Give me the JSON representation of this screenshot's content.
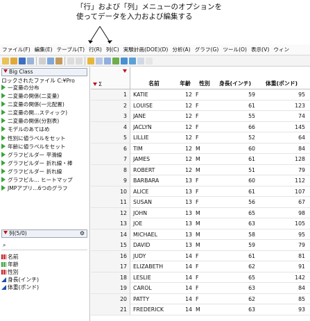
{
  "callout": {
    "line1": "「行」および「列」メニューのオプションを",
    "line2": "使ってデータを入力および編集する"
  },
  "menubar": {
    "items": [
      "ファイル(F)",
      "編集(E)",
      "テーブル(T)",
      "行(R)",
      "列(C)",
      "実験計画(DOE)(D)",
      "分析(A)",
      "グラフ(G)",
      "ツール(O)",
      "表示(V)",
      "ウィン"
    ]
  },
  "table_panel": {
    "title": "Big Class",
    "source_label": "ロックされたファイル  C:¥Pro",
    "scripts": [
      "一変量の分布",
      "二変量の関係(二変量)",
      "二変量の関係(一元配置)",
      "二変量の関…スティック)",
      "二変量の関係(分割表)",
      "モデルのあてはめ",
      "性別に値ラベルをセット",
      "年齢に値ラベルをセット",
      "グラフビルダー  平滑線",
      "グラフビルダー  折れ線・棒",
      "グラフビルダー  折れ線",
      "グラフビル…  ヒートマップ",
      "JMPアプリ…6つのグラフ"
    ]
  },
  "columns_panel": {
    "title": "列(5/0)",
    "search_placeholder": "",
    "columns": [
      {
        "name": "名前",
        "type": "nominal"
      },
      {
        "name": "年齢",
        "type": "ordinal"
      },
      {
        "name": "性別",
        "type": "nominal"
      },
      {
        "name": "身長(インチ)",
        "type": "continuous"
      },
      {
        "name": "体重(ポンド)",
        "type": "continuous"
      }
    ]
  },
  "grid": {
    "corner_label": "Σ",
    "headers": {
      "name": "名前",
      "age": "年齢",
      "sex": "性別",
      "height": "身長(インチ)",
      "weight": "体重(ポンド)"
    },
    "rows": [
      [
        "1",
        "KATIE",
        "12",
        "F",
        "59",
        "95"
      ],
      [
        "2",
        "LOUISE",
        "12",
        "F",
        "61",
        "123"
      ],
      [
        "3",
        "JANE",
        "12",
        "F",
        "55",
        "74"
      ],
      [
        "4",
        "JACLYN",
        "12",
        "F",
        "66",
        "145"
      ],
      [
        "5",
        "LILLIE",
        "12",
        "F",
        "52",
        "64"
      ],
      [
        "6",
        "TIM",
        "12",
        "M",
        "60",
        "84"
      ],
      [
        "7",
        "JAMES",
        "12",
        "M",
        "61",
        "128"
      ],
      [
        "8",
        "ROBERT",
        "12",
        "M",
        "51",
        "79"
      ],
      [
        "9",
        "BARBARA",
        "13",
        "F",
        "60",
        "112"
      ],
      [
        "10",
        "ALICE",
        "13",
        "F",
        "61",
        "107"
      ],
      [
        "11",
        "SUSAN",
        "13",
        "F",
        "56",
        "67"
      ],
      [
        "12",
        "JOHN",
        "13",
        "M",
        "65",
        "98"
      ],
      [
        "13",
        "JOE",
        "13",
        "M",
        "63",
        "105"
      ],
      [
        "14",
        "MICHAEL",
        "13",
        "M",
        "58",
        "95"
      ],
      [
        "15",
        "DAVID",
        "13",
        "M",
        "59",
        "79"
      ],
      [
        "16",
        "JUDY",
        "14",
        "F",
        "61",
        "81"
      ],
      [
        "17",
        "ELIZABETH",
        "14",
        "F",
        "62",
        "91"
      ],
      [
        "18",
        "LESLIE",
        "14",
        "F",
        "65",
        "142"
      ],
      [
        "19",
        "CAROL",
        "14",
        "F",
        "63",
        "84"
      ],
      [
        "20",
        "PATTY",
        "14",
        "F",
        "62",
        "85"
      ],
      [
        "21",
        "FREDERICK",
        "14",
        "M",
        "63",
        "93"
      ]
    ]
  },
  "colors": {
    "accent_red": "#c0101a",
    "script_green": "#3aa33a",
    "continuous_blue": "#1f4fa8"
  }
}
